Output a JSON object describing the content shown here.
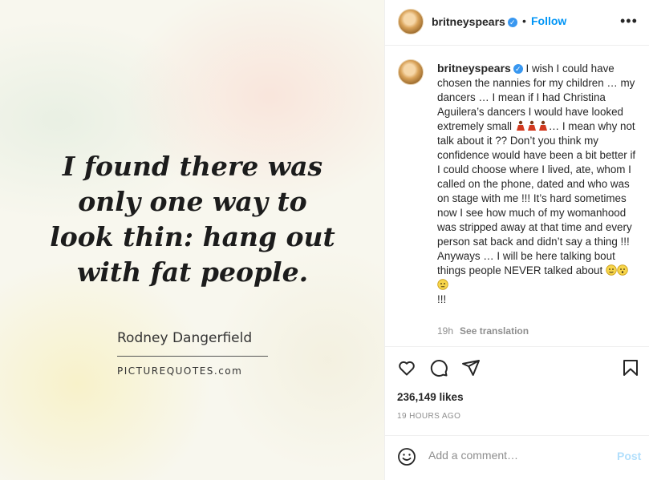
{
  "image": {
    "quote_lines": [
      "I found there was",
      "only one way to",
      "look thin: hang out",
      "with fat people."
    ],
    "author": "Rodney Dangerfield",
    "brand": "PICTUREQUOTES.com"
  },
  "header": {
    "username": "britneyspears",
    "separator": "•",
    "follow_label": "Follow",
    "more_label": "•••"
  },
  "caption": {
    "username": "britneyspears",
    "text_part1": " I wish I could have chosen the nannies for my children … my dancers … I mean if I had Christina Aguilera’s dancers I would have looked extremely small ",
    "text_part2": "… I mean why not talk about it ?? Don’t you think my confidence would have been a bit better if I could choose where I lived, ate, whom I called on the phone, dated and who was on stage with me !!! It’s hard sometimes now I see how much of my womanhood was stripped away at that time and every person sat back and didn’t say a thing !!! Anyways … I will be here talking bout things people NEVER talked about ",
    "text_part3": "!!!",
    "age": "19h",
    "see_translation": "See translation"
  },
  "actions": {
    "icons": [
      "heart-icon",
      "comment-icon",
      "share-icon",
      "bookmark-icon"
    ]
  },
  "likes": "236,149 likes",
  "timestamp": "19 HOURS AGO",
  "comment": {
    "placeholder": "Add a comment…",
    "post_label": "Post"
  },
  "colors": {
    "accent": "#0095f6",
    "verified": "#3897f0",
    "post_disabled": "#b2dffc",
    "muted": "#8e8e8e"
  }
}
